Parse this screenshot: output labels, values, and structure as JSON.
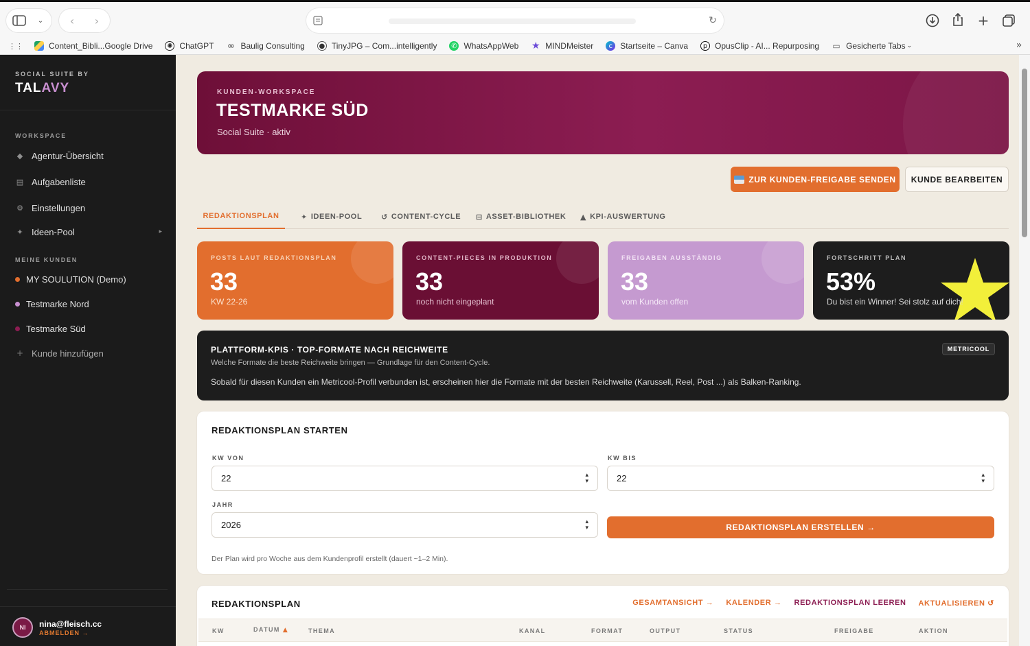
{
  "browser": {
    "bookmarks": [
      {
        "label": "Content_Bibli...Google Drive",
        "icon": "google-drive-icon",
        "color": "#2a9d4b"
      },
      {
        "label": "ChatGPT",
        "icon": "chatgpt-icon",
        "color": "#222222"
      },
      {
        "label": "Baulig Consulting",
        "icon": "infinity-icon",
        "color": "#222222"
      },
      {
        "label": "TinyJPG – Com...intelligently",
        "icon": "panda-icon",
        "color": "#444444"
      },
      {
        "label": "WhatsAppWeb",
        "icon": "whatsapp-icon",
        "color": "#25d366"
      },
      {
        "label": "MINDMeister",
        "icon": "star-icon",
        "color": "#6b4bd8"
      },
      {
        "label": "Startseite – Canva",
        "icon": "canva-icon",
        "color": "#5a63e0"
      },
      {
        "label": "OpusClip - AI... Repurposing",
        "icon": "opusclip-icon",
        "color": "#111111"
      },
      {
        "label": "Gesicherte Tabs",
        "icon": "folder-icon",
        "color": "#777777"
      }
    ]
  },
  "sidebar": {
    "brand_small": "SOCIAL SUITE BY",
    "brand_main": "TAL",
    "brand_accent": "AVY",
    "workspace_section": "WORKSPACE",
    "workspace_items": [
      {
        "label": "Agentur-Übersicht",
        "icon": "diamond-icon"
      },
      {
        "label": "Aufgabenliste",
        "icon": "clipboard-icon"
      },
      {
        "label": "Einstellungen",
        "icon": "gear-icon"
      },
      {
        "label": "Ideen-Pool",
        "icon": "sparkle-icon"
      }
    ],
    "clients_section": "MEINE KUNDEN",
    "clients": [
      {
        "label": "MY SOULUTION (Demo)",
        "color": "#e26e2e"
      },
      {
        "label": "Testmarke Nord",
        "color": "#c88fd0"
      },
      {
        "label": "Testmarke Süd",
        "color": "#8c1d52"
      }
    ],
    "add_client": "Kunde hinzufügen",
    "user": {
      "initials": "NI",
      "email": "nina@fleisch.cc",
      "logout": "ABMELDEN →"
    }
  },
  "hero": {
    "kicker": "KUNDEN-WORKSPACE",
    "title": "TESTMARKE SÜD",
    "subtitle": "Social Suite · aktiv"
  },
  "actions": {
    "send_approval": "ZUR KUNDEN-FREIGABE SENDEN",
    "edit_client": "KUNDE BEARBEITEN"
  },
  "tabs": [
    {
      "label": "REDAKTIONSPLAN",
      "icon": ""
    },
    {
      "label": "IDEEN-POOL",
      "icon": "✦"
    },
    {
      "label": "CONTENT-CYCLE",
      "icon": "↺"
    },
    {
      "label": "ASSET-BIBLIOTHEK",
      "icon": "⊟"
    },
    {
      "label": "KPI-AUSWERTUNG",
      "icon": "▲"
    }
  ],
  "kpis": [
    {
      "label": "POSTS LAUT REDAKTIONSPLAN",
      "value": "33",
      "sub": "KW 22-26",
      "bg": "#e26e2e"
    },
    {
      "label": "CONTENT-PIECES IN PRODUKTION",
      "value": "33",
      "sub": "noch nicht eingeplant",
      "bg": "#6a0f34"
    },
    {
      "label": "FREIGABEN AUSSTÄNDIG",
      "value": "33",
      "sub": "vom Kunden offen",
      "bg": "#c59ad0"
    },
    {
      "label": "FORTSCHRITT PLAN",
      "value": "53%",
      "sub": "Du bist ein Winner! Sei stolz auf dich!",
      "bg": "#1d1d1d"
    }
  ],
  "platform": {
    "title": "PLATTFORM-KPIS · TOP-FORMATE NACH REICHWEITE",
    "subtitle": "Welche Formate die beste Reichweite bringen — Grundlage für den Content-Cycle.",
    "text": "Sobald für diesen Kunden ein Metricool-Profil verbunden ist, erscheinen hier die Formate mit der besten Reichweite (Karussell, Reel, Post ...) als Balken-Ranking.",
    "badge": "METRICOOL"
  },
  "start_plan": {
    "title": "REDAKTIONSPLAN STARTEN",
    "kw_from_label": "KW VON",
    "kw_from_value": "22",
    "kw_to_label": "KW BIS",
    "kw_to_value": "22",
    "year_label": "JAHR",
    "year_value": "2026",
    "create_button": "REDAKTIONSPLAN ERSTELLEN →",
    "hint": "Der Plan wird pro Woche aus dem Kundenprofil erstellt (dauert ~1–2 Min)."
  },
  "plan_table": {
    "title": "REDAKTIONSPLAN",
    "links": {
      "overview": "GESAMTANSICHT →",
      "calendar": "KALENDER →",
      "clear": "REDAKTIONSPLAN LEEREN",
      "refresh": "AKTUALISIEREN ↺"
    },
    "columns": [
      "KW",
      "DATUM",
      "THEMA",
      "KANAL",
      "FORMAT",
      "OUTPUT",
      "STATUS",
      "FREIGABE",
      "AKTION"
    ]
  }
}
